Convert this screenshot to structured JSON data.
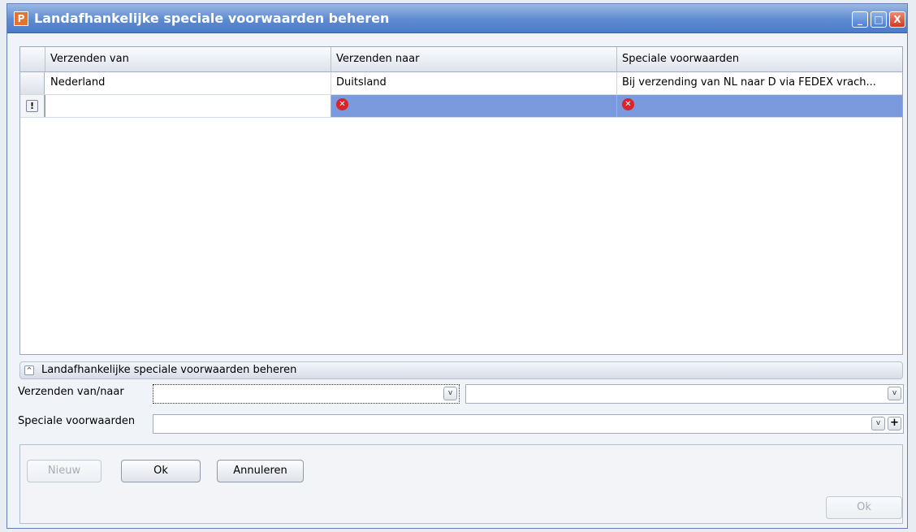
{
  "window": {
    "title": "Landafhankelijke speciale voorwaarden beheren",
    "icon_letter": "P",
    "controls": {
      "minimize": "_",
      "maximize": "□",
      "close": "X"
    }
  },
  "grid": {
    "columns": [
      "Verzenden van",
      "Verzenden naar",
      "Speciale voorwaarden"
    ],
    "rows": [
      {
        "from": "Nederland",
        "to": "Duitsland",
        "conditions": "Bij verzending van NL naar D via FEDEX vrach..."
      }
    ],
    "new_row": {
      "marker": "!",
      "error_glyph": "✕"
    }
  },
  "group": {
    "title": "Landafhankelijke speciale voorwaarden beheren",
    "collapse_glyph": "^"
  },
  "form": {
    "ship_label": "Verzenden van/naar",
    "ship_from_value": "",
    "ship_to_value": "",
    "conditions_label": "Speciale voorwaarden",
    "conditions_value": "",
    "dropdown_glyph": "v",
    "add_glyph": "+"
  },
  "buttons": {
    "new": "Nieuw",
    "ok": "Ok",
    "cancel": "Annuleren",
    "ok_bottom": "Ok"
  }
}
